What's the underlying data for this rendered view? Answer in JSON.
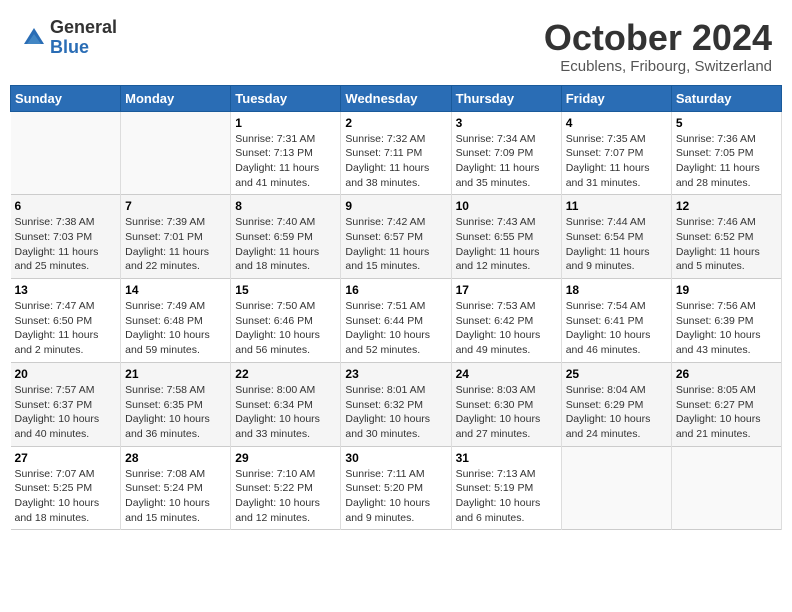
{
  "header": {
    "logo_general": "General",
    "logo_blue": "Blue",
    "month_title": "October 2024",
    "location": "Ecublens, Fribourg, Switzerland"
  },
  "days_of_week": [
    "Sunday",
    "Monday",
    "Tuesday",
    "Wednesday",
    "Thursday",
    "Friday",
    "Saturday"
  ],
  "weeks": [
    [
      {
        "day": "",
        "info": ""
      },
      {
        "day": "",
        "info": ""
      },
      {
        "day": "1",
        "info": "Sunrise: 7:31 AM\nSunset: 7:13 PM\nDaylight: 11 hours and 41 minutes."
      },
      {
        "day": "2",
        "info": "Sunrise: 7:32 AM\nSunset: 7:11 PM\nDaylight: 11 hours and 38 minutes."
      },
      {
        "day": "3",
        "info": "Sunrise: 7:34 AM\nSunset: 7:09 PM\nDaylight: 11 hours and 35 minutes."
      },
      {
        "day": "4",
        "info": "Sunrise: 7:35 AM\nSunset: 7:07 PM\nDaylight: 11 hours and 31 minutes."
      },
      {
        "day": "5",
        "info": "Sunrise: 7:36 AM\nSunset: 7:05 PM\nDaylight: 11 hours and 28 minutes."
      }
    ],
    [
      {
        "day": "6",
        "info": "Sunrise: 7:38 AM\nSunset: 7:03 PM\nDaylight: 11 hours and 25 minutes."
      },
      {
        "day": "7",
        "info": "Sunrise: 7:39 AM\nSunset: 7:01 PM\nDaylight: 11 hours and 22 minutes."
      },
      {
        "day": "8",
        "info": "Sunrise: 7:40 AM\nSunset: 6:59 PM\nDaylight: 11 hours and 18 minutes."
      },
      {
        "day": "9",
        "info": "Sunrise: 7:42 AM\nSunset: 6:57 PM\nDaylight: 11 hours and 15 minutes."
      },
      {
        "day": "10",
        "info": "Sunrise: 7:43 AM\nSunset: 6:55 PM\nDaylight: 11 hours and 12 minutes."
      },
      {
        "day": "11",
        "info": "Sunrise: 7:44 AM\nSunset: 6:54 PM\nDaylight: 11 hours and 9 minutes."
      },
      {
        "day": "12",
        "info": "Sunrise: 7:46 AM\nSunset: 6:52 PM\nDaylight: 11 hours and 5 minutes."
      }
    ],
    [
      {
        "day": "13",
        "info": "Sunrise: 7:47 AM\nSunset: 6:50 PM\nDaylight: 11 hours and 2 minutes."
      },
      {
        "day": "14",
        "info": "Sunrise: 7:49 AM\nSunset: 6:48 PM\nDaylight: 10 hours and 59 minutes."
      },
      {
        "day": "15",
        "info": "Sunrise: 7:50 AM\nSunset: 6:46 PM\nDaylight: 10 hours and 56 minutes."
      },
      {
        "day": "16",
        "info": "Sunrise: 7:51 AM\nSunset: 6:44 PM\nDaylight: 10 hours and 52 minutes."
      },
      {
        "day": "17",
        "info": "Sunrise: 7:53 AM\nSunset: 6:42 PM\nDaylight: 10 hours and 49 minutes."
      },
      {
        "day": "18",
        "info": "Sunrise: 7:54 AM\nSunset: 6:41 PM\nDaylight: 10 hours and 46 minutes."
      },
      {
        "day": "19",
        "info": "Sunrise: 7:56 AM\nSunset: 6:39 PM\nDaylight: 10 hours and 43 minutes."
      }
    ],
    [
      {
        "day": "20",
        "info": "Sunrise: 7:57 AM\nSunset: 6:37 PM\nDaylight: 10 hours and 40 minutes."
      },
      {
        "day": "21",
        "info": "Sunrise: 7:58 AM\nSunset: 6:35 PM\nDaylight: 10 hours and 36 minutes."
      },
      {
        "day": "22",
        "info": "Sunrise: 8:00 AM\nSunset: 6:34 PM\nDaylight: 10 hours and 33 minutes."
      },
      {
        "day": "23",
        "info": "Sunrise: 8:01 AM\nSunset: 6:32 PM\nDaylight: 10 hours and 30 minutes."
      },
      {
        "day": "24",
        "info": "Sunrise: 8:03 AM\nSunset: 6:30 PM\nDaylight: 10 hours and 27 minutes."
      },
      {
        "day": "25",
        "info": "Sunrise: 8:04 AM\nSunset: 6:29 PM\nDaylight: 10 hours and 24 minutes."
      },
      {
        "day": "26",
        "info": "Sunrise: 8:05 AM\nSunset: 6:27 PM\nDaylight: 10 hours and 21 minutes."
      }
    ],
    [
      {
        "day": "27",
        "info": "Sunrise: 7:07 AM\nSunset: 5:25 PM\nDaylight: 10 hours and 18 minutes."
      },
      {
        "day": "28",
        "info": "Sunrise: 7:08 AM\nSunset: 5:24 PM\nDaylight: 10 hours and 15 minutes."
      },
      {
        "day": "29",
        "info": "Sunrise: 7:10 AM\nSunset: 5:22 PM\nDaylight: 10 hours and 12 minutes."
      },
      {
        "day": "30",
        "info": "Sunrise: 7:11 AM\nSunset: 5:20 PM\nDaylight: 10 hours and 9 minutes."
      },
      {
        "day": "31",
        "info": "Sunrise: 7:13 AM\nSunset: 5:19 PM\nDaylight: 10 hours and 6 minutes."
      },
      {
        "day": "",
        "info": ""
      },
      {
        "day": "",
        "info": ""
      }
    ]
  ]
}
